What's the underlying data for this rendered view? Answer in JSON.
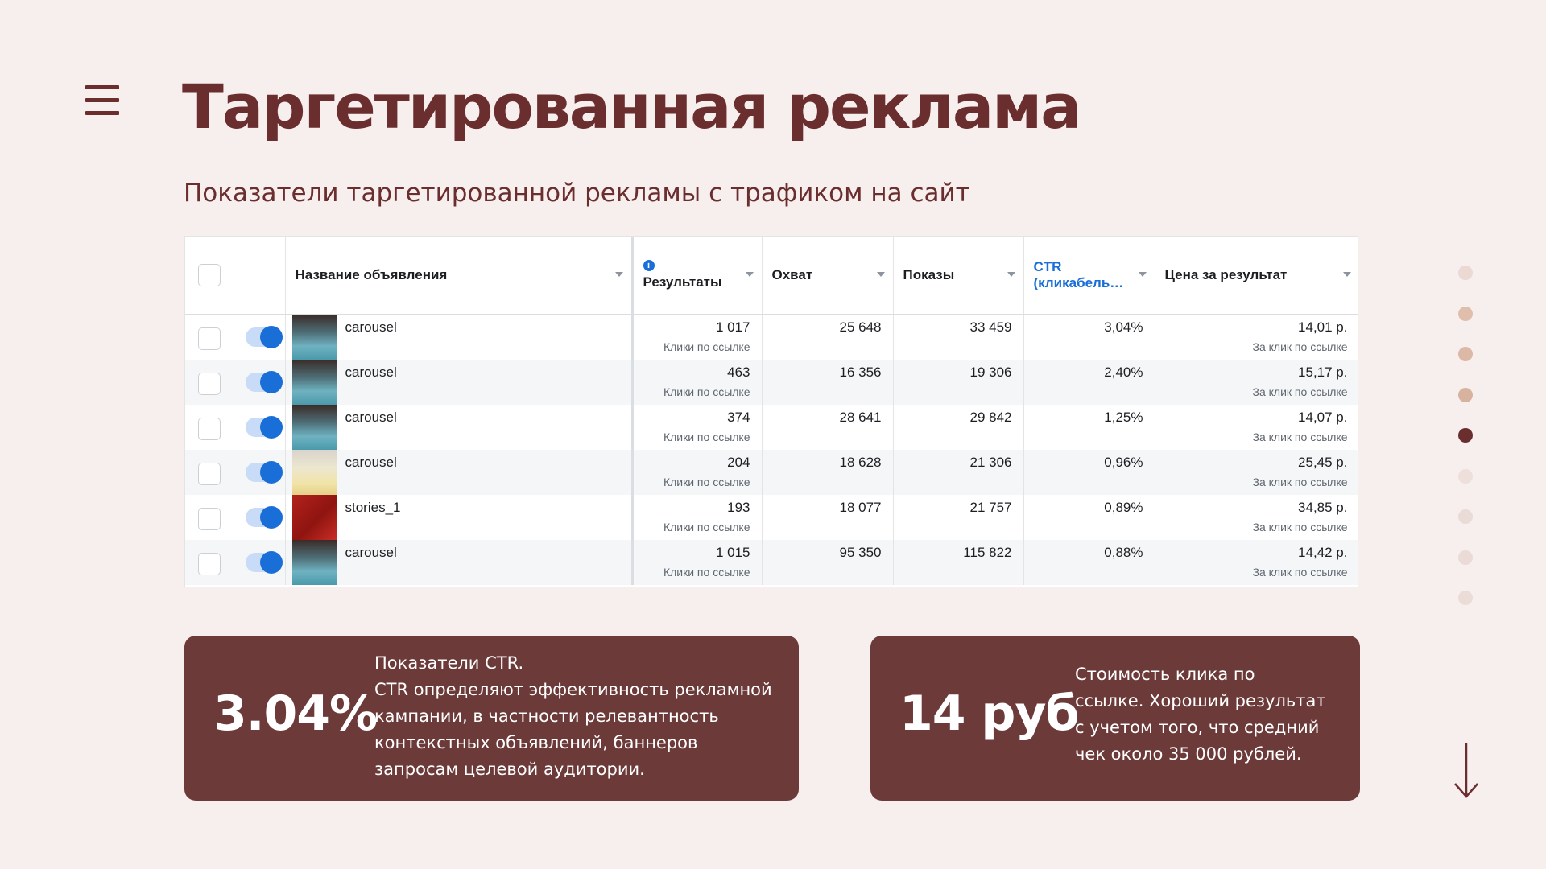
{
  "header": {
    "title": "Таргетированная реклама",
    "subtitle": "Показатели таргетированной рекламы с трафиком на сайт"
  },
  "table": {
    "columns": {
      "name": "Название объявления",
      "results": "Результаты",
      "reach": "Охват",
      "impressions": "Показы",
      "ctr_line1": "CTR",
      "ctr_line2": "(кликабель…",
      "price": "Цена за результат"
    },
    "rows": [
      {
        "thumb": "blue",
        "name": "carousel",
        "results": "1 017",
        "results_sub": "Клики по ссылке",
        "reach": "25 648",
        "impressions": "33 459",
        "ctr": "3,04%",
        "price": "14,01 р.",
        "price_sub": "За клик по ссылке"
      },
      {
        "thumb": "blue",
        "name": "carousel",
        "results": "463",
        "results_sub": "Клики по ссылке",
        "reach": "16 356",
        "impressions": "19 306",
        "ctr": "2,40%",
        "price": "15,17 р.",
        "price_sub": "За клик по ссылке"
      },
      {
        "thumb": "blue",
        "name": "carousel",
        "results": "374",
        "results_sub": "Клики по ссылке",
        "reach": "28 641",
        "impressions": "29 842",
        "ctr": "1,25%",
        "price": "14,07 р.",
        "price_sub": "За клик по ссылке"
      },
      {
        "thumb": "yellow",
        "name": "carousel",
        "results": "204",
        "results_sub": "Клики по ссылке",
        "reach": "18 628",
        "impressions": "21 306",
        "ctr": "0,96%",
        "price": "25,45 р.",
        "price_sub": "За клик по ссылке"
      },
      {
        "thumb": "red",
        "name": "stories_1",
        "results": "193",
        "results_sub": "Клики по ссылке",
        "reach": "18 077",
        "impressions": "21 757",
        "ctr": "0,89%",
        "price": "34,85 р.",
        "price_sub": "За клик по ссылке"
      },
      {
        "thumb": "blue",
        "name": "carousel",
        "results": "1 015",
        "results_sub": "Клики по ссылке",
        "reach": "95 350",
        "impressions": "115 822",
        "ctr": "0,88%",
        "price": "14,42 р.",
        "price_sub": "За клик по ссылке"
      }
    ]
  },
  "cards": [
    {
      "value": "3.04%",
      "text_lines": [
        "Показатели CTR.",
        "CTR определяют эффективность рекламной",
        "кампании, в частности релевантность",
        "контекстных объявлений, баннеров",
        "запросам целевой аудитории."
      ]
    },
    {
      "value": "14 руб",
      "text_lines": [
        "Стоимость клика по",
        "ссылке. Хороший результат",
        "с учетом того, что средний",
        "чек около 35 000 рублей."
      ]
    }
  ],
  "nav_dots": {
    "active_index": 4,
    "colors": [
      "#ecd9d4",
      "#dfbfab",
      "#dcb9a6",
      "#d7b39f",
      "#6b2e2e",
      "#efdfdb",
      "#eadbd6",
      "#eadbd6",
      "#ecdcd8"
    ]
  },
  "icons": {
    "menu": "hamburger-menu-icon",
    "down": "arrow-down-icon"
  },
  "colors": {
    "accent": "#6b2e2e",
    "card_bg": "#6d3a3a",
    "link_blue": "#1a6ed8",
    "background": "#f7eeee"
  }
}
